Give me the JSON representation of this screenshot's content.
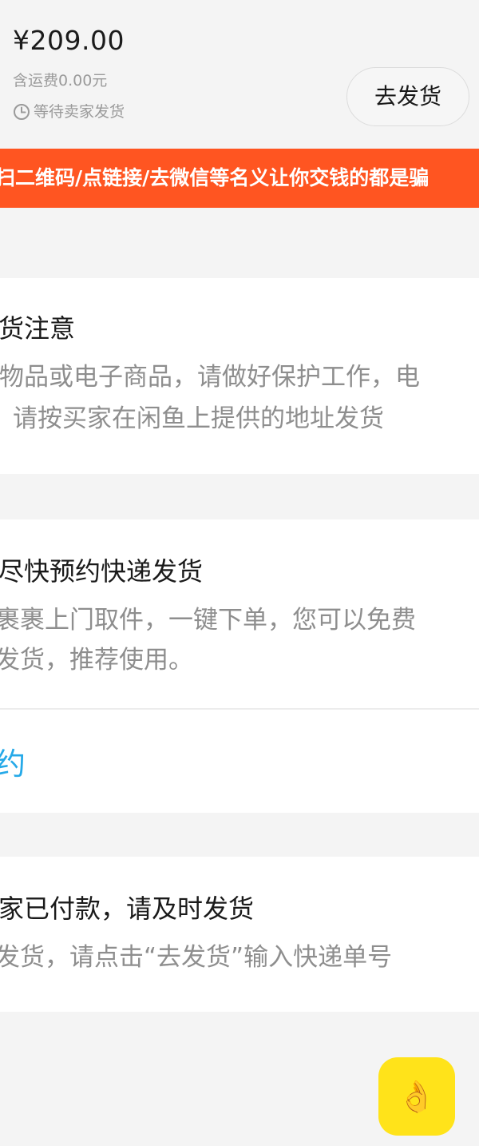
{
  "order": {
    "price": "¥209.00",
    "freight": "含运费0.00元",
    "status": "等待卖家发货",
    "ship_button": "去发货"
  },
  "banner": {
    "text": "扫二维码/点链接/去微信等名义让你交钱的都是骗"
  },
  "notice_card": {
    "title": "货注意",
    "line1": "物品或电子商品，请做好保护工作，电",
    "line2": "请按买家在闲鱼上提供的地址发货"
  },
  "courier_card": {
    "title": "尽快预约快递发货",
    "line1": "裹裹上门取件，一键下单，您可以免费",
    "line2": "发货，推荐使用。",
    "link": "约"
  },
  "paid_card": {
    "title": "家已付款，请及时发货",
    "line1": "发货，请点击“去发货”输入快递单号"
  },
  "fab": {
    "icon": "ok-hand-icon",
    "glyph": "👌",
    "color": "#ffe31a"
  },
  "colors": {
    "banner": "#ff5521",
    "link": "#25a9e8",
    "background": "#f4f4f4"
  }
}
